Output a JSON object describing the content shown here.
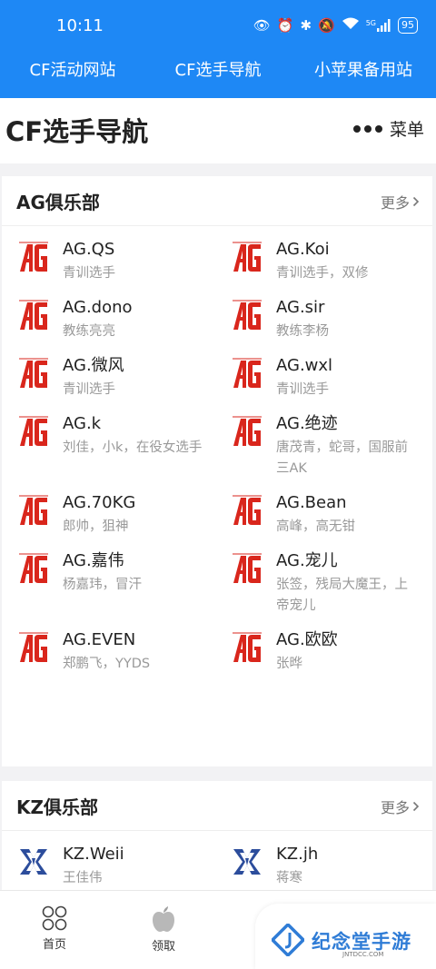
{
  "status": {
    "time": "10:11",
    "network": "5G",
    "battery": "95"
  },
  "topnav": [
    "CF活动网站",
    "CF选手导航",
    "小苹果备用站"
  ],
  "page": {
    "title": "CF选手导航",
    "menu_label": "菜单"
  },
  "colors": {
    "brand_blue": "#1e88f5",
    "ag_red": "#d9261c",
    "kz_blue": "#2c4d9c"
  },
  "sections": [
    {
      "title": "AG俱乐部",
      "more": "更多",
      "logo_icon": "ag-logo-icon",
      "players": [
        {
          "name": "AG.QS",
          "desc": "青训选手"
        },
        {
          "name": "AG.Koi",
          "desc": "青训选手，双修"
        },
        {
          "name": "AG.dono",
          "desc": "教练亮亮"
        },
        {
          "name": "AG.sir",
          "desc": "教练李杨"
        },
        {
          "name": "AG.微风",
          "desc": "青训选手"
        },
        {
          "name": "AG.wxl",
          "desc": "青训选手"
        },
        {
          "name": "AG.k",
          "desc": "刘佳，小k，在役女选手"
        },
        {
          "name": "AG.绝迹",
          "desc": "唐茂青，蛇哥，国服前三AK"
        },
        {
          "name": "AG.70KG",
          "desc": "郎帅，狙神"
        },
        {
          "name": "AG.Bean",
          "desc": "高峰，高无钳"
        },
        {
          "name": "AG.嘉伟",
          "desc": "杨嘉玮，冒汗"
        },
        {
          "name": "AG.宠儿",
          "desc": "张签，残局大魔王，上帝宠儿"
        },
        {
          "name": "AG.EVEN",
          "desc": "郑鹏飞，YYDS"
        },
        {
          "name": "AG.欧欧",
          "desc": "张晔"
        }
      ]
    },
    {
      "title": "KZ俱乐部",
      "more": "更多",
      "logo_icon": "kz-logo-icon",
      "players": [
        {
          "name": "KZ.Weii",
          "desc": "王佳伟"
        },
        {
          "name": "KZ.jh",
          "desc": "蒋寒"
        }
      ]
    }
  ],
  "bottom_tabs": [
    {
      "label": "首页",
      "icon": "grid-circles-icon"
    },
    {
      "label": "领取",
      "icon": "apple-icon"
    },
    {
      "label": "",
      "icon": "apple-icon"
    },
    {
      "label": "",
      "icon": "green-apple-icon"
    }
  ],
  "watermark": {
    "name": "纪念堂手游",
    "url": "JNTDCC.COM"
  }
}
